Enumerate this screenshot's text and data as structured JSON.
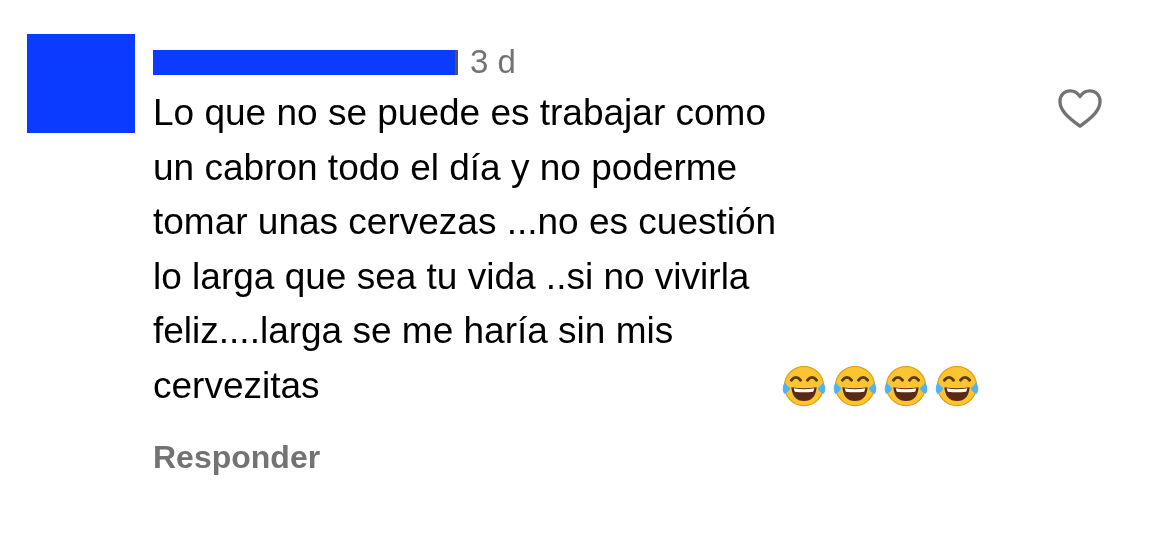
{
  "comment": {
    "time": "3 d",
    "lines": [
      "Lo que no se puede es trabajar como",
      "un cabron todo el día y no poderme",
      "tomar unas cervezas ...no es cuestión",
      "lo larga que sea tu vida ..si no vivirla",
      "feliz....larga se me haría sin mis",
      "cervezitas"
    ],
    "emojis": [
      {
        "kind": "tears-of-joy"
      },
      {
        "kind": "tears-of-joy"
      },
      {
        "kind": "tears-of-joy"
      },
      {
        "kind": "tears-of-joy"
      }
    ],
    "liked": false,
    "reply": "Responder"
  }
}
